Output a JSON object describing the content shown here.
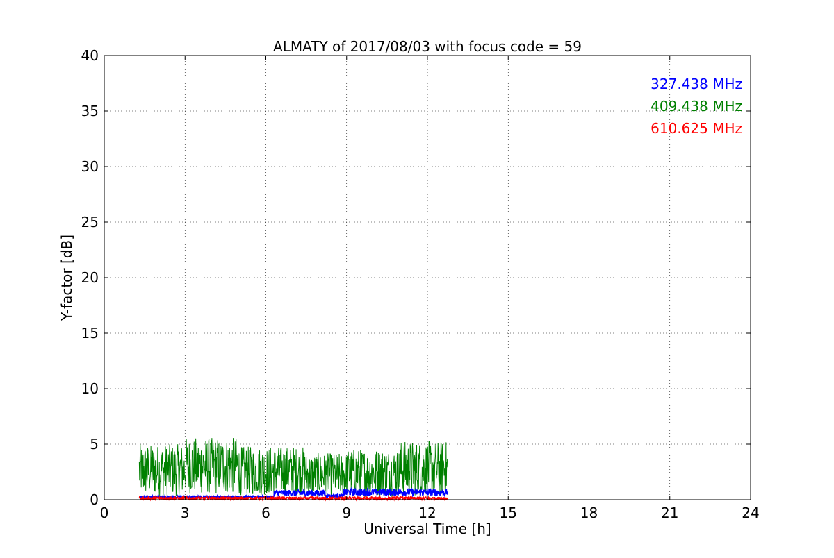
{
  "chart_data": {
    "type": "line",
    "title": "ALMATY of 2017/08/03 with focus code = 59",
    "xlabel": "Universal Time [h]",
    "ylabel": "Y-factor [dB]",
    "xlim": [
      0,
      24
    ],
    "ylim": [
      0,
      40
    ],
    "xticks": [
      0,
      3,
      6,
      9,
      12,
      15,
      18,
      21,
      24
    ],
    "yticks": [
      0,
      5,
      10,
      15,
      20,
      25,
      30,
      35,
      40
    ],
    "xtick_labels": [
      "0",
      "3",
      "6",
      "9",
      "12",
      "15",
      "18",
      "21",
      "24"
    ],
    "ytick_labels": [
      "0",
      "5",
      "10",
      "15",
      "20",
      "25",
      "30",
      "35",
      "40"
    ],
    "grid": true,
    "legend_position": "top-right",
    "series": [
      {
        "name": "327.438 MHz",
        "color": "#0000ff",
        "x_start": 1.3,
        "x_end": 12.75,
        "segments": [
          {
            "from": 1.3,
            "to": 6.3,
            "min": 0.15,
            "max": 0.35
          },
          {
            "from": 6.3,
            "to": 8.2,
            "min": 0.3,
            "max": 0.9
          },
          {
            "from": 8.2,
            "to": 8.9,
            "min": 0.2,
            "max": 0.5
          },
          {
            "from": 8.9,
            "to": 12.75,
            "min": 0.35,
            "max": 1.0
          }
        ]
      },
      {
        "name": "409.438 MHz",
        "color": "#008000",
        "x_start": 1.3,
        "x_end": 12.75,
        "segments": [
          {
            "from": 1.3,
            "to": 3.0,
            "min": 0.3,
            "max": 5.0
          },
          {
            "from": 3.0,
            "to": 5.0,
            "min": 0.5,
            "max": 5.6
          },
          {
            "from": 5.0,
            "to": 7.5,
            "min": 0.4,
            "max": 4.8
          },
          {
            "from": 7.5,
            "to": 9.0,
            "min": 0.3,
            "max": 4.2
          },
          {
            "from": 9.0,
            "to": 11.0,
            "min": 0.3,
            "max": 4.6
          },
          {
            "from": 11.0,
            "to": 12.75,
            "min": 0.3,
            "max": 5.3
          }
        ]
      },
      {
        "name": "610.625 MHz",
        "color": "#ff0000",
        "x_start": 1.3,
        "x_end": 12.75,
        "segments": [
          {
            "from": 1.3,
            "to": 12.75,
            "min": 0.0,
            "max": 0.25
          }
        ]
      }
    ]
  }
}
